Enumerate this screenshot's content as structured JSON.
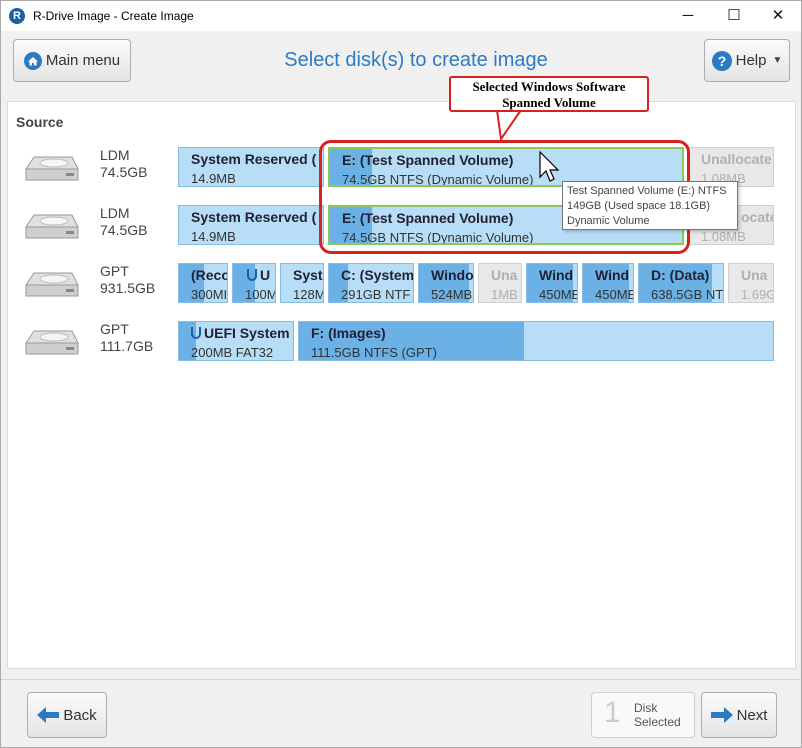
{
  "window": {
    "title": "R-Drive Image - Create Image",
    "app_icon_letter": "R",
    "minimize": "─",
    "maximize": "☐",
    "close": "✕"
  },
  "header": {
    "main_menu_label": "Main menu",
    "title": "Select disk(s) to create image",
    "help_label": "Help"
  },
  "source_label": "Source",
  "disks": [
    {
      "type": "LDM",
      "size": "74.5GB",
      "partitions": [
        {
          "name": "System Reserved (",
          "info": "14.9MB",
          "used": 0
        },
        {
          "name": "E: (Test Spanned Volume)",
          "info": "74.5GB NTFS (Dynamic Volume)",
          "used": 0.12,
          "selected": true
        },
        {
          "name": "Unallocate",
          "info": "1.08MB",
          "unallocated": true
        }
      ]
    },
    {
      "type": "LDM",
      "size": "74.5GB",
      "partitions": [
        {
          "name": "System Reserved (",
          "info": "14.9MB",
          "used": 0
        },
        {
          "name": "E: (Test Spanned Volume)",
          "info": "74.5GB NTFS (Dynamic Volume)",
          "used": 0.12,
          "selected": true
        },
        {
          "name": "ocate",
          "info": "1.08MB",
          "unallocated": true
        }
      ]
    },
    {
      "type": "GPT",
      "size": "931.5GB",
      "partitions": [
        {
          "name": "(Reco",
          "info": "300MI",
          "used": 0.5
        },
        {
          "name": "U",
          "info": "100M",
          "used": 0.5,
          "shield": true
        },
        {
          "name": "Syste",
          "info": "128M",
          "used": 0
        },
        {
          "name": "C: (System",
          "info": "291GB NTF",
          "used": 0.22
        },
        {
          "name": "Windo",
          "info": "524MB",
          "used": 0.9
        },
        {
          "name": "Una",
          "info": "1MB",
          "unallocated": true
        },
        {
          "name": "Wind",
          "info": "450ME",
          "used": 0.9
        },
        {
          "name": "Wind",
          "info": "450ME",
          "used": 0.9
        },
        {
          "name": "D: (Data)",
          "info": "638.5GB NTF",
          "used": 0.85
        },
        {
          "name": "Una",
          "info": "1.69G",
          "unallocated": true
        }
      ]
    },
    {
      "type": "GPT",
      "size": "111.7GB",
      "partitions": [
        {
          "name": "UEFI System",
          "info": "200MB FAT32",
          "used": 0.15,
          "shield": true
        },
        {
          "name": "F: (Images)",
          "info": "111.5GB NTFS (GPT)",
          "used": 0.47
        }
      ]
    }
  ],
  "callout": {
    "line1": "Selected Windows Software",
    "line2": "Spanned Volume"
  },
  "tooltip": {
    "line1": "Test Spanned Volume (E:) NTFS",
    "line2": "149GB (Used space 18.1GB)",
    "line3": "Dynamic Volume"
  },
  "footer": {
    "back_label": "Back",
    "disk_selected_count": "1",
    "disk_selected_line1": "Disk",
    "disk_selected_line2": "Selected",
    "next_label": "Next"
  },
  "colors": {
    "accent": "#2b7bc3",
    "partition_bg": "#b8ddf6",
    "partition_used": "#6cb1e6",
    "highlight_red": "#d9201f",
    "selected_green": "#8ac858"
  }
}
